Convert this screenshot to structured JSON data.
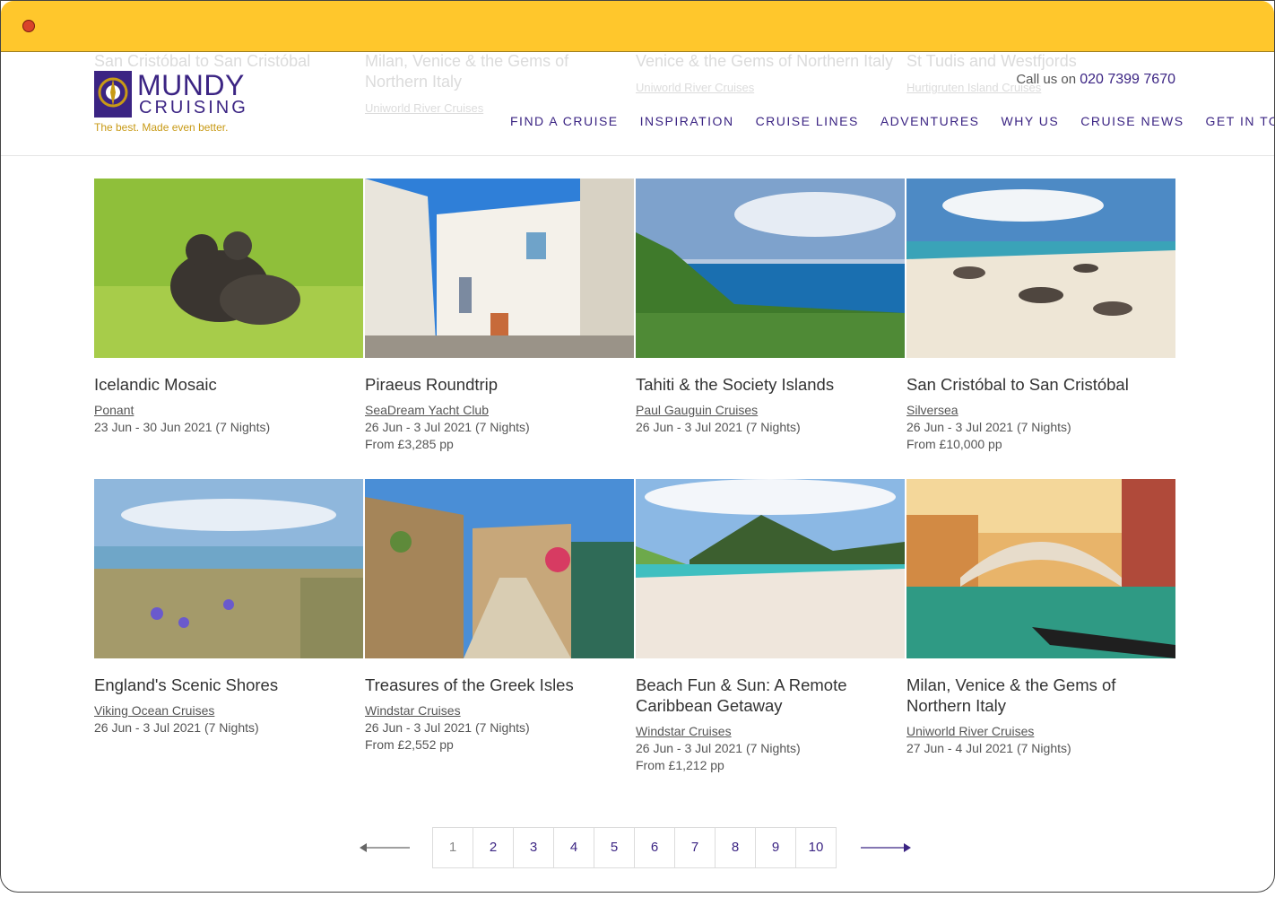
{
  "header": {
    "logo": {
      "brand": "MUNDY",
      "brand2": "CRUISING",
      "tagline": "The best. Made even better."
    },
    "call_label": "Call us on",
    "phone": "020 7399 7670",
    "nav": [
      "FIND A CRUISE",
      "INSPIRATION",
      "CRUISE LINES",
      "ADVENTURES",
      "WHY US",
      "CRUISE NEWS",
      "GET IN TOUCH"
    ]
  },
  "ghost_cards": [
    {
      "title": "San Cristóbal to San Cristóbal"
    },
    {
      "title": "Milan, Venice & the Gems of Northern Italy",
      "line": "Uniworld River Cruises"
    },
    {
      "title": "Venice & the Gems of Northern Italy",
      "line": "Uniworld River Cruises"
    },
    {
      "title": "St Tudis and Westfjords",
      "line": "Hurtigruten Island Cruises"
    }
  ],
  "cards": [
    {
      "title": "Icelandic Mosaic",
      "cruise_line": "Ponant",
      "dates": "23 Jun - 30 Jun 2021 (7 Nights)",
      "price": ""
    },
    {
      "title": "Piraeus Roundtrip",
      "cruise_line": "SeaDream Yacht Club",
      "dates": "26 Jun - 3 Jul 2021 (7 Nights)",
      "price": "From £3,285 pp"
    },
    {
      "title": "Tahiti & the Society Islands",
      "cruise_line": "Paul Gauguin Cruises",
      "dates": "26 Jun - 3 Jul 2021 (7 Nights)",
      "price": ""
    },
    {
      "title": "San Cristóbal to San Cristóbal",
      "cruise_line": "Silversea",
      "dates": "26 Jun - 3 Jul 2021 (7 Nights)",
      "price": "From £10,000 pp"
    },
    {
      "title": "England's Scenic Shores",
      "cruise_line": "Viking Ocean Cruises",
      "dates": "26 Jun - 3 Jul 2021 (7 Nights)",
      "price": ""
    },
    {
      "title": "Treasures of the Greek Isles",
      "cruise_line": "Windstar Cruises",
      "dates": "26 Jun - 3 Jul 2021 (7 Nights)",
      "price": "From £2,552 pp"
    },
    {
      "title": "Beach Fun & Sun: A Remote Caribbean Getaway",
      "cruise_line": "Windstar Cruises",
      "dates": "26 Jun - 3 Jul 2021 (7 Nights)",
      "price": "From £1,212 pp"
    },
    {
      "title": "Milan, Venice & the Gems of Northern Italy",
      "cruise_line": "Uniworld River Cruises",
      "dates": "27 Jun - 4 Jul 2021 (7 Nights)",
      "price": ""
    }
  ],
  "pagination": {
    "pages": [
      "1",
      "2",
      "3",
      "4",
      "5",
      "6",
      "7",
      "8",
      "9",
      "10"
    ],
    "current": "1"
  }
}
